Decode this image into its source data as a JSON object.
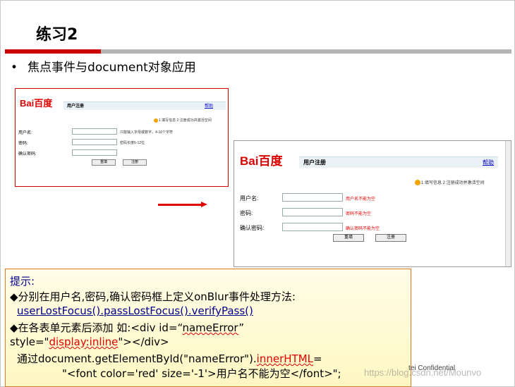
{
  "slide": {
    "title": "练习2",
    "bullet": "焦点事件与document对象应用"
  },
  "form_small": {
    "logo": "Bai百度",
    "header_title": "用户注册",
    "help": "帮助",
    "steps": "1 填写信息  2 注册成功并激活空间",
    "fields": [
      {
        "label": "用户名:",
        "hint": "只能输入字母或数字，4-16个字符"
      },
      {
        "label": "密码:",
        "hint": "密码长度6-12位"
      },
      {
        "label": "确认密码:",
        "hint": ""
      }
    ],
    "buttons": {
      "reset": "重填",
      "register": "注册"
    }
  },
  "form_large": {
    "logo": "Bai百度",
    "header_title": "用户注册",
    "help": "帮助",
    "steps": "1 填写信息  2 注册成功并激活空间",
    "fields": [
      {
        "label": "用户名:",
        "error": "用户名不能为空"
      },
      {
        "label": "密码:",
        "error": "密码不能为空"
      },
      {
        "label": "确认密码:",
        "error": "确认密码不能为空"
      }
    ],
    "buttons": {
      "reset": "重填",
      "register": "注册"
    }
  },
  "tip": {
    "heading": "提示:",
    "line1": "◆分别在用户名,密码,确认密码框上定义onBlur事件处理方法:",
    "line2": "userLostFocus().passLostFocus().verifyPass()",
    "line3_a": "◆在各表单元素后添加 如:<div id=“",
    "line3_b": "nameError",
    "line3_c": "”",
    "line4_a": "style=\"",
    "line4_b": "display:inline",
    "line4_c": "\"></div>",
    "line5_a": "通过document.getElementById(\"nameError\").",
    "line5_b": "innerHTML",
    "line5_c": "=",
    "line6": "\"<font color='red' size='-1'>用户名不能为空</font>\";"
  },
  "footer": {
    "confidential": "tei Confidential",
    "watermark": "https://blog.csdn.net/Mounvo"
  }
}
